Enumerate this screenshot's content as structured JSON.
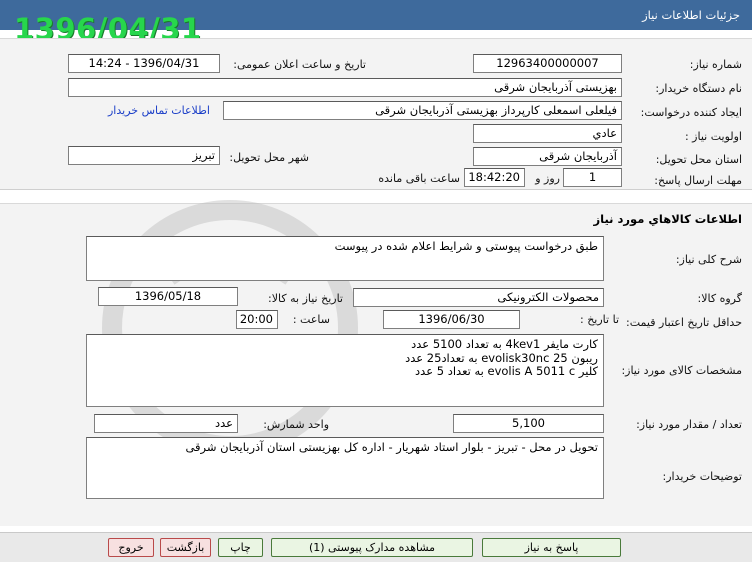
{
  "header": {
    "title": "جزئیات اطلاعات نیاز"
  },
  "stamp_date": "1396/04/31",
  "fields": {
    "need_number_label": "شماره نیاز:",
    "need_number": "12963400000007",
    "announce_label": "تاریخ و ساعت اعلان عمومی:",
    "announce_value": "1396/04/31 - 14:24",
    "buyer_org_label": "نام دستگاه خریدار:",
    "buyer_org": "بهزیستی آذربایجان شرقی",
    "creator_label": "ایجاد کننده درخواست:",
    "creator": "فیلعلی  اسمعلی کارپرداز بهزیستی آذربایجان شرقی",
    "contact_link": "اطلاعات تماس خریدار",
    "priority_label": "اولویت نیاز :",
    "priority": "عادي",
    "province_label": "استان محل تحویل:",
    "province": "آذربایجان شرقی",
    "city_label": "شهر محل تحویل:",
    "city": "تبریز",
    "deadline_label": "مهلت ارسال پاسخ:",
    "deadline_days": "1",
    "days_label": "روز و",
    "deadline_time": "18:42:20",
    "remaining_label": "ساعت باقی مانده"
  },
  "goods": {
    "section_title": "اطلاعات کالاهاي مورد نياز",
    "summary_label": "شرح کلی نیاز:",
    "summary": "طبق درخواست پیوستی و شرایط اعلام شده در پیوست",
    "group_label": "گروه کالا:",
    "group": "محصولات الکترونیکی",
    "need_date_label": "تاریخ نیاز به کالا:",
    "need_date": "1396/05/18",
    "validity_label": "حداقل تاریخ اعتبار قیمت:",
    "until_date_label": "تا تاریخ :",
    "validity_date": "1396/06/30",
    "time_label": "ساعت :",
    "validity_time": "20:00",
    "specs_label": "مشخصات کالای مورد نیاز:",
    "specs_lines": [
      "کارت مایفر 4kev1 به تعداد 5100 عدد",
      "ریبون evolisk30nc 25 به تعداد25 عدد",
      "کلیر evolis A 5011 c به تعداد 5 عدد"
    ],
    "qty_label": "تعداد / مقدار مورد نیاز:",
    "qty": "5,100",
    "unit_label": "واحد شمارش:",
    "unit": "عدد",
    "buyer_notes_label": "توضیحات خریدار:",
    "buyer_notes": "تحویل در محل - تبریز - بلوار استاد شهریار - اداره کل بهزیستی استان آذربایجان شرقی"
  },
  "buttons": {
    "reply": "پاسخ به نیاز",
    "view_docs": "مشاهده مدارک پیوستی (1)",
    "print": "چاپ",
    "back": "بازگشت",
    "exit": "خروج"
  },
  "colors": {
    "header": "#3e6a9c",
    "stamp": "#27d64c",
    "link": "#1a3ec8"
  }
}
